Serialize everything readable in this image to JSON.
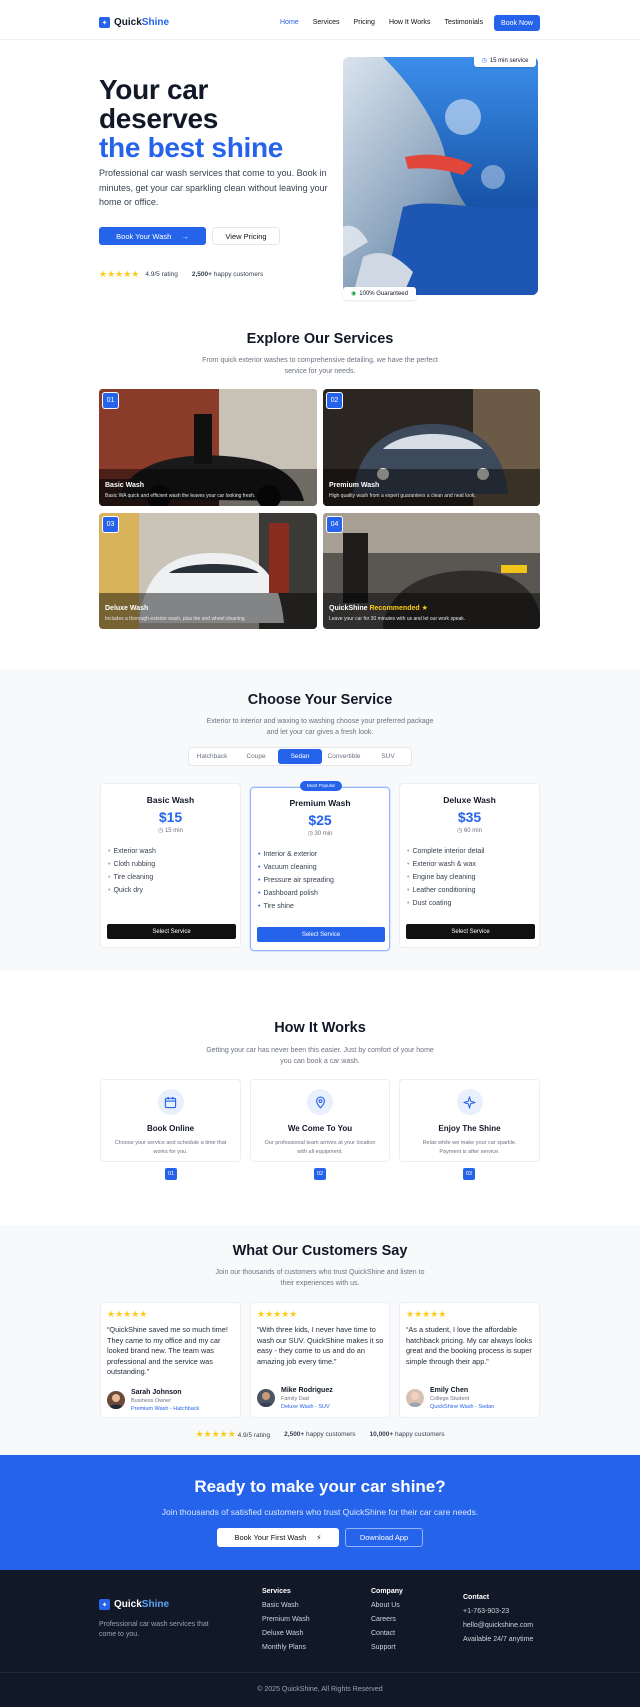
{
  "brand": {
    "pre": "Quick",
    "post": "Shine",
    "accent": "#2563eb"
  },
  "nav": {
    "links": [
      "Home",
      "Services",
      "Pricing",
      "How It Works",
      "Testimonials"
    ],
    "cta": "Book Now"
  },
  "hero": {
    "title_line1": "Your car",
    "title_line2": "deserves",
    "title_line3": "the best shine",
    "subtitle": "Professional car wash services that come to you. Book in minutes, get your car sparkling clean without leaving your home or office.",
    "primary_cta": "Book Your Wash",
    "secondary_cta": "View Pricing",
    "rating": "4.9/5 rating",
    "customers_count": "2,500+",
    "customers_label": "happy customers",
    "badge_top": "15 min service",
    "badge_bottom": "100% Guaranteed"
  },
  "services": {
    "title": "Explore Our Services",
    "subtitle": "From quick exterior washes to comprehensive detailing, we have the perfect service for your needs.",
    "items": [
      {
        "num": "01",
        "name": "Basic Wash",
        "desc": "Basic WA quick and efficient wash the leaves your car looking fresh."
      },
      {
        "num": "02",
        "name": "Premium Wash",
        "desc": "High quality wash from a expert guarantees a clean and neat look."
      },
      {
        "num": "03",
        "name": "Deluxe Wash",
        "desc": "Includes a thorough exterior wash, plus tire and wheel cleaning."
      },
      {
        "num": "04",
        "name_pre": "QuickShine",
        "name_post": "Recommended",
        "desc": "Leave your car for 30 minutes with us and let our work speak."
      }
    ]
  },
  "pricing": {
    "title": "Choose Your Service",
    "subtitle": "Exterior to interior and waxing to washing choose your preferred package and let your car gives a fresh look.",
    "tabs": [
      "Hatchback",
      "Coupe",
      "Sedan",
      "Convertible",
      "SUV"
    ],
    "selected_tab": "Sedan",
    "plans": [
      {
        "name": "Basic Wash",
        "price": "$15",
        "duration": "15 min",
        "features": [
          "Exterior wash",
          "Cloth rubbing",
          "Tire cleaning",
          "Quick dry"
        ],
        "button": "Select Service"
      },
      {
        "name": "Premium Wash",
        "badge": "Most Popular",
        "price": "$25",
        "duration": "30 min",
        "features": [
          "Interior & exterior",
          "Vacuum cleaning",
          "Pressure air spreading",
          "Dashboard polish",
          "Tire shine"
        ],
        "button": "Select Service"
      },
      {
        "name": "Deluxe Wash",
        "price": "$35",
        "duration": "60 min",
        "features": [
          "Complete interior detail",
          "Exterior wash & wax",
          "Engine bay cleaning",
          "Leather conditioning",
          "Dust coating"
        ],
        "button": "Select Service"
      }
    ]
  },
  "how": {
    "title": "How It Works",
    "subtitle": "Getting your car has never been this easier. Just by comfort of your home you can book a car wash.",
    "steps": [
      {
        "icon": "calendar-icon",
        "name": "Book Online",
        "desc": "Choose your service and schedule a time that works for you.",
        "num": "01"
      },
      {
        "icon": "location-pin-icon",
        "name": "We Come To You",
        "desc": "Our professional team arrives at your location with all equipment.",
        "num": "02"
      },
      {
        "icon": "sparkle-icon",
        "name": "Enjoy The Shine",
        "desc": "Relax while we make your car sparkle. Payment is after service.",
        "num": "03"
      }
    ]
  },
  "testimonials": {
    "title": "What Our Customers Say",
    "subtitle": "Join our thousands of customers who trust QuickShine and listen to their experiences with us.",
    "items": [
      {
        "quote": "“QuickShine saved me so much time! They came to my office and my car looked brand new. The team was professional and the service was outstanding.”",
        "name": "Sarah Johnson",
        "role": "Business Owner",
        "plan": "Premium Wash - Hatchback"
      },
      {
        "quote": "“With three kids, I never have time to wash our SUV. QuickShine makes it so easy - they come to us and do an amazing job every time.”",
        "name": "Mike Rodriguez",
        "role": "Family Dad",
        "plan": "Deluxe Wash - SUV"
      },
      {
        "quote": "“As a student, I love the affordable hatchback pricing. My car always looks great and the booking process is super simple through their app.”",
        "name": "Emily Chen",
        "role": "College Student",
        "plan": "QuickShine Wash - Sedan"
      }
    ],
    "stats": {
      "rating": "4.9/5 rating",
      "s1_num": "2,500+",
      "s1_label": "happy customers",
      "s2_num": "10,000+",
      "s2_label": "happy customers"
    }
  },
  "cta": {
    "title": "Ready to make your car shine?",
    "subtitle": "Join thousands of satisfied customers who trust QuickShine for their car care needs.",
    "primary": "Book Your First Wash",
    "secondary": "Download App"
  },
  "footer": {
    "tagline": "Professional car wash services that come to you.",
    "services_heading": "Services",
    "services": [
      "Basic Wash",
      "Premium Wash",
      "Deluxe Wash",
      "Monthly Plans"
    ],
    "company_heading": "Company",
    "company": [
      "About Us",
      "Careers",
      "Contact",
      "Support"
    ],
    "contact_heading": "Contact",
    "contact": [
      "+1-763-903-23",
      "hello@quickshine.com",
      "Available 24/7 anytime"
    ],
    "copyright": "© 2025 QuickShine, All Rights Reserved"
  }
}
